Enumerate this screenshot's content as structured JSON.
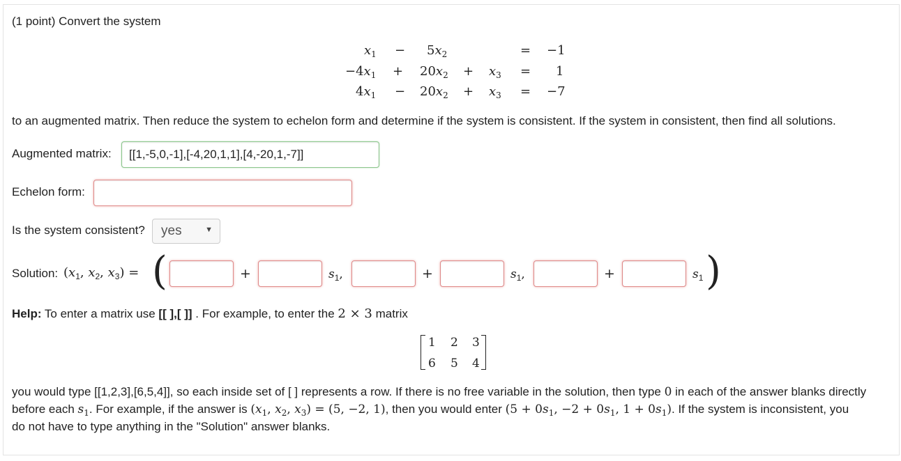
{
  "problem": {
    "intro": "(1 point) Convert the system",
    "system_rows": [
      [
        "x1",
        "−",
        "5x2",
        "",
        "",
        "=",
        "−1"
      ],
      [
        "−4x1",
        "+",
        "20x2",
        "+",
        "x3",
        "=",
        "1"
      ],
      [
        "4x1",
        "−",
        "20x2",
        "+",
        "x3",
        "=",
        "−7"
      ]
    ],
    "instructions": "to an augmented matrix. Then reduce the system to echelon form and determine if the system is consistent. If the system in consistent, then find all solutions."
  },
  "augmented": {
    "label": "Augmented matrix:",
    "value": "[[1,-5,0,-1],[-4,20,1,1],[4,-20,1,-7]]"
  },
  "echelon": {
    "label": "Echelon form:",
    "value": ""
  },
  "consistent": {
    "label": "Is the system consistent?",
    "selected": "yes"
  },
  "solution": {
    "label": "Solution:",
    "separator_plus": "+",
    "free_var": "s1"
  },
  "help": {
    "bold": "Help:",
    "text1": "To enter a matrix use",
    "syntax": "[[ ],[ ]]",
    "text2": ". For example, to enter the",
    "dims": "2 × 3",
    "text3": "matrix",
    "matrix": [
      [
        "1",
        "2",
        "3"
      ],
      [
        "6",
        "5",
        "4"
      ]
    ],
    "para1_line1": "you would type [[1,2,3],[6,5,4]], so each inside set of [ ] represents a row. If there is no free variable in the solution, then type",
    "zero": "0",
    "para1_line1_end": "in each of the answer blanks directly",
    "para1_line2a": "before each",
    "para1_line2b": ". For example, if the answer is",
    "example_lhs": "(x1, x2, x3) = (5, −2, 1)",
    "para1_line2c": ", then you would enter",
    "example_entry": "(5 + 0s1, −2 + 0s1, 1 + 0s1)",
    "para1_line2d": ". If the system is inconsistent, you",
    "para1_line3": "do not have to type anything in the \"Solution\" answer blanks."
  }
}
